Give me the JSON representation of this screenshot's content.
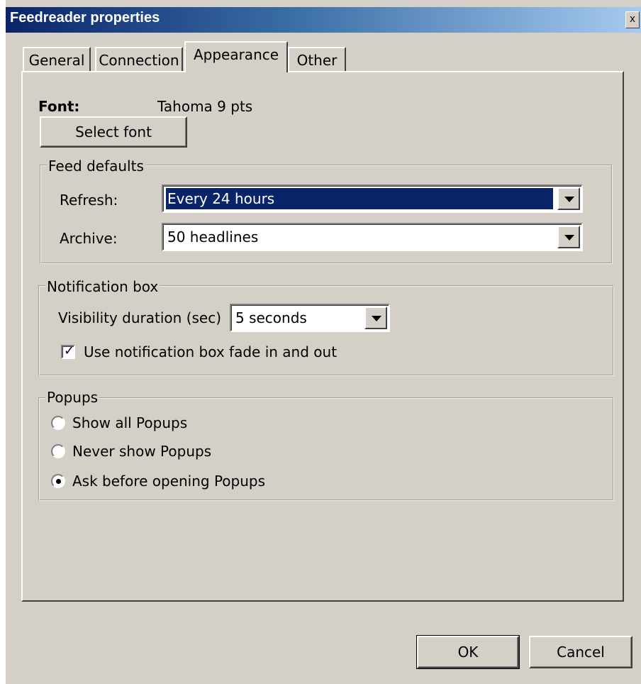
{
  "window": {
    "title": "Feedreader properties",
    "close_glyph": "x"
  },
  "tabs": [
    {
      "label": "General",
      "active": false
    },
    {
      "label": "Connection",
      "active": false
    },
    {
      "label": "Appearance",
      "active": true
    },
    {
      "label": "Other",
      "active": false
    }
  ],
  "font": {
    "label": "Font:",
    "value": "Tahoma 9 pts",
    "button": "Select font"
  },
  "feed_defaults": {
    "legend": "Feed defaults",
    "refresh_label": "Refresh:",
    "refresh_value": "Every 24 hours",
    "archive_label": "Archive:",
    "archive_value": "50 headlines"
  },
  "notification": {
    "legend": "Notification box",
    "duration_label": "Visibility duration (sec)",
    "duration_value": "5 seconds",
    "fade_label": "Use notification box fade in and out",
    "fade_checked": true
  },
  "popups": {
    "legend": "Popups",
    "options": [
      {
        "label": "Show all Popups",
        "selected": false
      },
      {
        "label": "Never show Popups",
        "selected": false
      },
      {
        "label": "Ask before opening Popups",
        "selected": true
      }
    ]
  },
  "buttons": {
    "ok": "OK",
    "cancel": "Cancel"
  }
}
